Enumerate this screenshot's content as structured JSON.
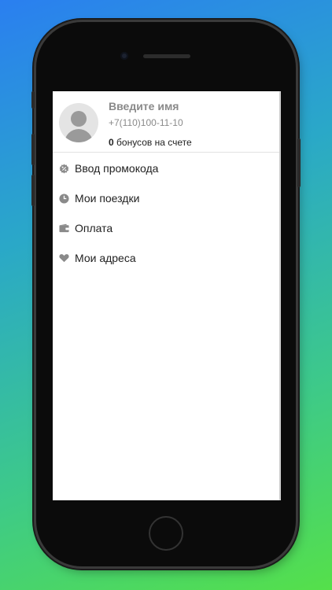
{
  "profile": {
    "name_placeholder": "Введите имя",
    "phone": "+7(110)100-11-10",
    "bonus_count": "0",
    "bonus_text": " бонусов на счете"
  },
  "menu": {
    "items": [
      {
        "label": "Ввод промокода",
        "icon": "promo-icon"
      },
      {
        "label": "Мои поездки",
        "icon": "clock-icon"
      },
      {
        "label": "Оплата",
        "icon": "wallet-icon"
      },
      {
        "label": "Мои адреса",
        "icon": "heart-icon"
      }
    ]
  },
  "colors": {
    "icon": "#8a8a8a",
    "text": "#222222",
    "muted": "#8a8a8a"
  }
}
